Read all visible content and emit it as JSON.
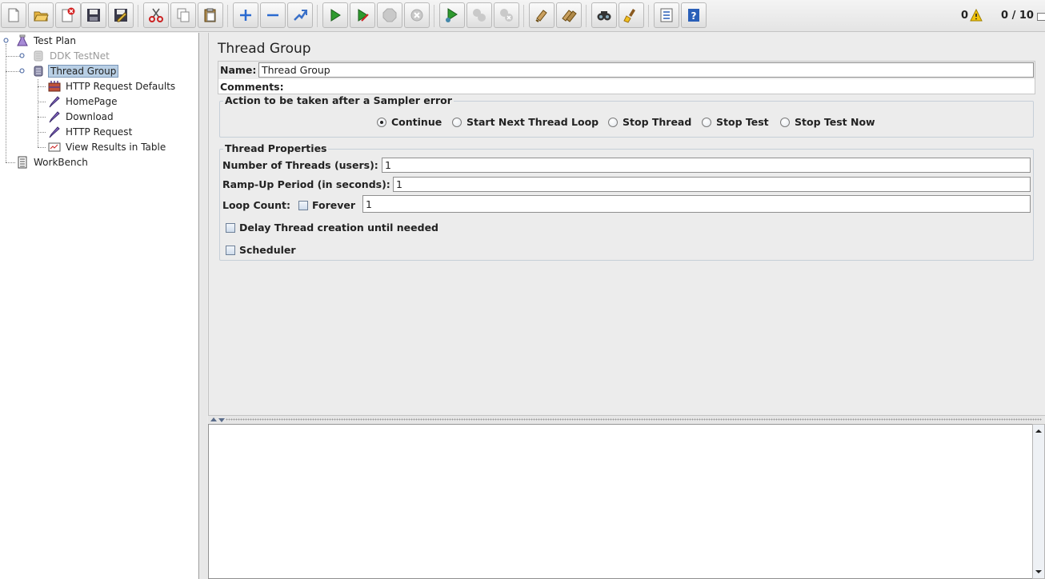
{
  "toolbar": {
    "buttons": [
      {
        "name": "new-icon"
      },
      {
        "name": "open-icon"
      },
      {
        "name": "close-file-icon"
      },
      {
        "name": "save-icon"
      },
      {
        "name": "save-as-icon"
      },
      {
        "name": "cut-icon"
      },
      {
        "name": "copy-icon"
      },
      {
        "name": "paste-icon"
      },
      {
        "name": "expand-icon"
      },
      {
        "name": "collapse-icon"
      },
      {
        "name": "toggle-icon"
      },
      {
        "name": "start-icon"
      },
      {
        "name": "start-no-pauses-icon"
      },
      {
        "name": "stop-icon"
      },
      {
        "name": "shutdown-icon"
      },
      {
        "name": "remote-start-icon"
      },
      {
        "name": "remote-stop-icon"
      },
      {
        "name": "remote-shutdown-icon"
      },
      {
        "name": "clear-icon"
      },
      {
        "name": "clear-all-icon"
      },
      {
        "name": "search-icon"
      },
      {
        "name": "reset-search-icon"
      },
      {
        "name": "function-helper-icon"
      },
      {
        "name": "help-icon"
      }
    ],
    "error_count": "0",
    "thread_count": "0 / 10"
  },
  "tree": {
    "items": [
      {
        "label": "Test Plan",
        "icon": "test-plan-icon"
      },
      {
        "label": "DDK TestNet",
        "icon": "thread-group-icon",
        "disabled": true
      },
      {
        "label": "Thread Group",
        "icon": "thread-group-icon",
        "selected": true
      },
      {
        "label": "HTTP Request Defaults",
        "icon": "config-element-icon"
      },
      {
        "label": "HomePage",
        "icon": "sampler-icon"
      },
      {
        "label": "Download",
        "icon": "sampler-icon"
      },
      {
        "label": "HTTP Request",
        "icon": "sampler-icon"
      },
      {
        "label": "View Results in Table",
        "icon": "listener-icon"
      },
      {
        "label": "WorkBench",
        "icon": "workbench-icon"
      }
    ]
  },
  "panel": {
    "title": "Thread Group",
    "name_label": "Name:",
    "name_value": "Thread Group",
    "comments_label": "Comments:",
    "sampler_error": {
      "title": "Action to be taken after a Sampler error",
      "options": [
        "Continue",
        "Start Next Thread Loop",
        "Stop Thread",
        "Stop Test",
        "Stop Test Now"
      ],
      "selected": "Continue"
    },
    "thread_properties": {
      "title": "Thread Properties",
      "threads_label": "Number of Threads (users):",
      "threads_value": "1",
      "rampup_label": "Ramp-Up Period (in seconds):",
      "rampup_value": "1",
      "loop_label": "Loop Count:",
      "forever_label": "Forever",
      "loop_value": "1",
      "delay_label": "Delay Thread creation until needed",
      "scheduler_label": "Scheduler"
    }
  },
  "colors": {
    "selection": "#b8cfe5",
    "start_green": "#2e9a2e",
    "help_blue": "#2a5fb8"
  }
}
